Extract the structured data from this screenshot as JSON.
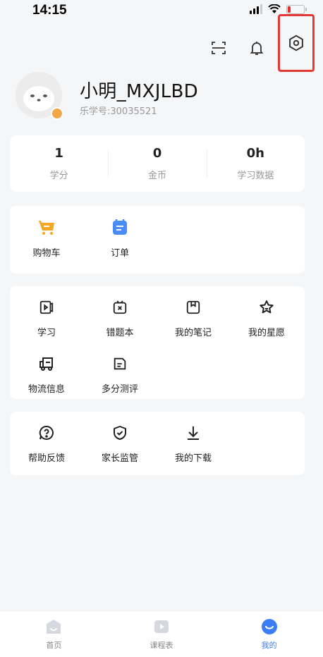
{
  "status_bar": {
    "time": "14:15"
  },
  "profile": {
    "username": "小明_MXJLBD",
    "learn_id": "乐学号:30035521"
  },
  "stats": [
    {
      "value": "1",
      "label": "学分"
    },
    {
      "value": "0",
      "label": "金币"
    },
    {
      "value": "0h",
      "label": "学习数据"
    }
  ],
  "shop_items": [
    {
      "label": "购物车"
    },
    {
      "label": "订单"
    }
  ],
  "learn_items": [
    {
      "label": "学习"
    },
    {
      "label": "错题本"
    },
    {
      "label": "我的笔记"
    },
    {
      "label": "我的星愿"
    },
    {
      "label": "物流信息"
    },
    {
      "label": "多分测评"
    }
  ],
  "help_items": [
    {
      "label": "帮助反馈"
    },
    {
      "label": "家长监管"
    },
    {
      "label": "我的下载"
    }
  ],
  "tabs": [
    {
      "label": "首页"
    },
    {
      "label": "课程表"
    },
    {
      "label": "我的"
    }
  ],
  "colors": {
    "accent": "#3a7df5",
    "highlight": "#e53935",
    "cart": "#f5a623",
    "order": "#4a8cf7"
  }
}
